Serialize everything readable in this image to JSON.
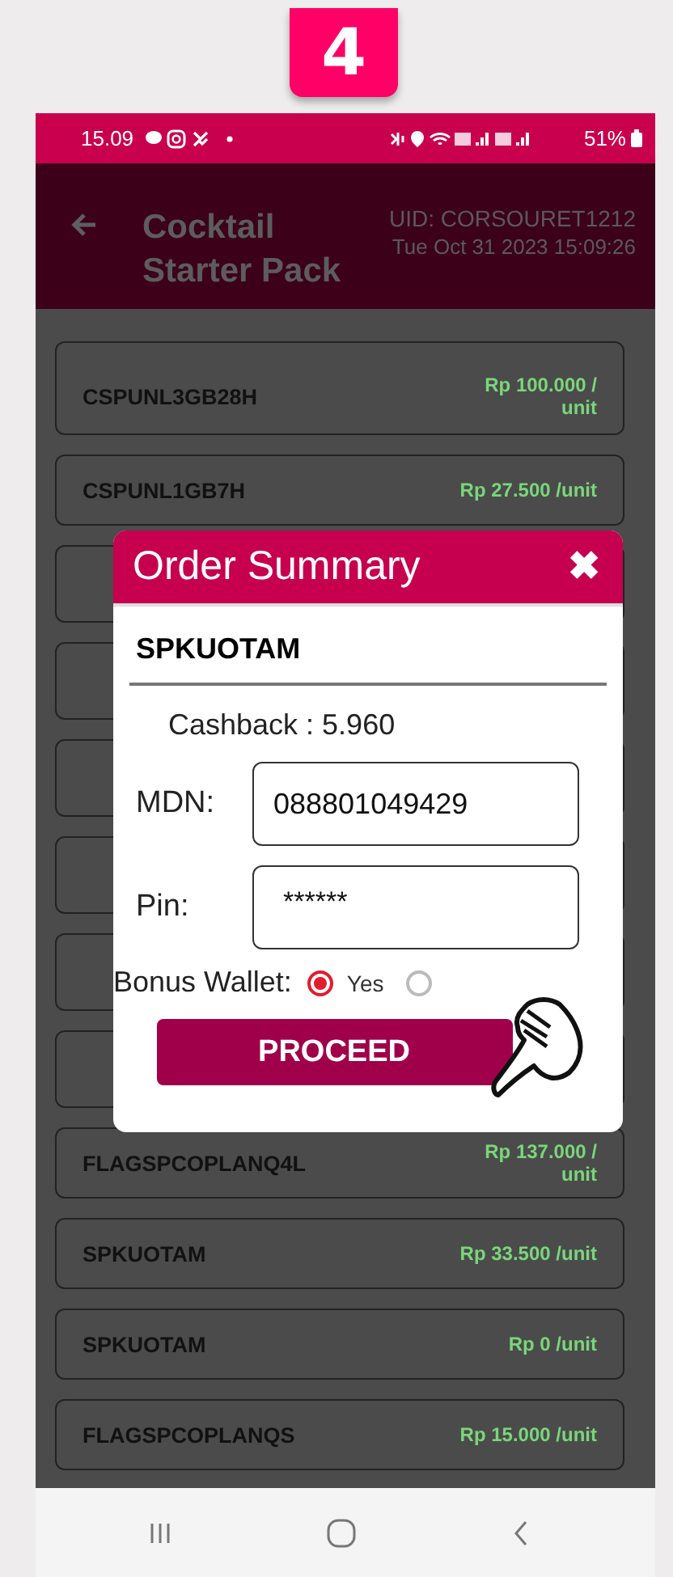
{
  "step_badge": "4",
  "status_bar": {
    "time": "15.09",
    "battery": "51%"
  },
  "header": {
    "title": "Cocktail Starter Pack",
    "uid": "UID: CORSOURET1212",
    "datetime": "Tue Oct 31 2023 15:09:26"
  },
  "products": [
    {
      "kind": "product",
      "name": "CSPUNL3GB28H",
      "price": "Rp 100.000 /\nunit"
    },
    {
      "kind": "product",
      "name": "CSPUNL1GB7H",
      "price": "Rp 27.500 /unit"
    },
    {
      "kind": "covered"
    },
    {
      "kind": "covered"
    },
    {
      "kind": "covered"
    },
    {
      "kind": "covered"
    },
    {
      "kind": "covered"
    },
    {
      "kind": "covered"
    },
    {
      "kind": "product",
      "name": "FLAGSPCOPLANQ4L",
      "price": "Rp 137.000 /\nunit"
    },
    {
      "kind": "product",
      "name": "SPKUOTAM",
      "price": "Rp 33.500 /unit"
    },
    {
      "kind": "product",
      "name": "SPKUOTAM",
      "price": "Rp 0 /unit"
    },
    {
      "kind": "product",
      "name": "FLAGSPCOPLANQS",
      "price": "Rp 15.000 /unit"
    }
  ],
  "dialog": {
    "title": "Order Summary",
    "close": "✖",
    "product": "SPKUOTAM",
    "cashback": "Cashback : 5.960",
    "fields": [
      {
        "label": "MDN:",
        "value": "088801049429"
      },
      {
        "label": "Pin:",
        "value": "******"
      }
    ],
    "bonus_wallet": {
      "label": "Bonus Wallet:",
      "options": [
        {
          "label": "Yes",
          "selected": true
        },
        {
          "selected": false
        }
      ]
    },
    "button": "PROCEED"
  }
}
